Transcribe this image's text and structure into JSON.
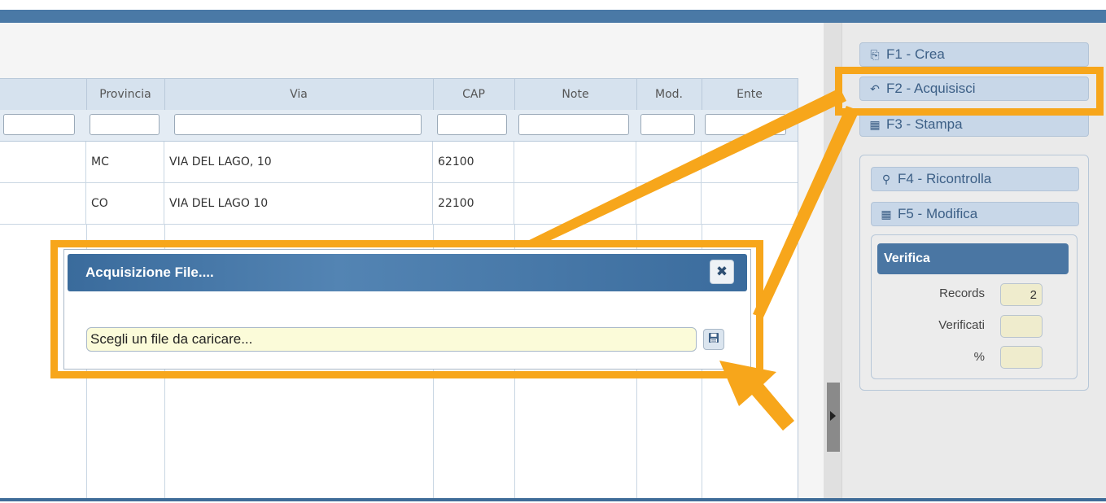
{
  "grid": {
    "columns": [
      "Provincia",
      "Via",
      "CAP",
      "Note",
      "Mod.",
      "Ente"
    ],
    "rows": [
      {
        "provincia": "MC",
        "via": "VIA DEL LAGO, 10",
        "cap": "62100",
        "note": "",
        "mod": "",
        "ente": ""
      },
      {
        "provincia": "CO",
        "via": "VIA DEL LAGO 10",
        "cap": "22100",
        "note": "",
        "mod": "",
        "ente": ""
      }
    ]
  },
  "toolbar": {
    "crea": {
      "label": "F1 - Crea",
      "icon": "printer-icon"
    },
    "acquisisci": {
      "label": "F2 - Acquisisci",
      "icon": "reply-arrow-icon"
    },
    "stampa": {
      "label": "F3 - Stampa",
      "icon": "save-disk-icon"
    },
    "ricontrolla": {
      "label": "F4 - Ricontrolla",
      "icon": "search-icon"
    },
    "modifica": {
      "label": "F5 - Modifica",
      "icon": "save-disk-icon"
    }
  },
  "verifica": {
    "title": "Verifica",
    "records_label": "Records",
    "records_value": "2",
    "verificati_label": "Verificati",
    "verificati_value": "",
    "percent_label": "%",
    "percent_value": ""
  },
  "dialog": {
    "title": "Acquisizione File....",
    "close_symbol": "✖",
    "file_placeholder": "Scegli un file da caricare..."
  },
  "colors": {
    "accent": "#4a79a6",
    "annotation": "#f7a61b",
    "input_yellow": "#fbfbd9"
  }
}
